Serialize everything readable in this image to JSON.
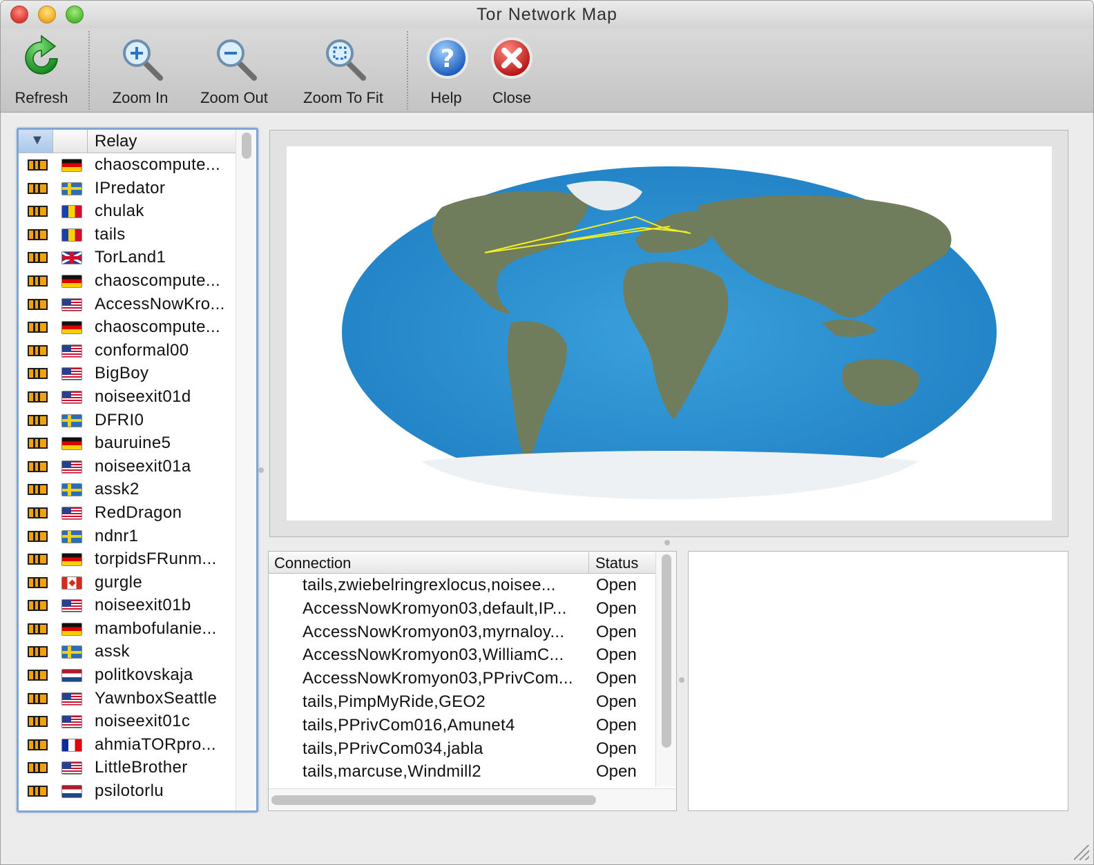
{
  "window": {
    "title": "Tor Network Map"
  },
  "toolbar": {
    "refresh": {
      "label": "Refresh",
      "icon": "refresh-icon"
    },
    "zoom_in": {
      "label": "Zoom In",
      "icon": "zoom-in-icon"
    },
    "zoom_out": {
      "label": "Zoom Out",
      "icon": "zoom-out-icon"
    },
    "zoom_fit": {
      "label": "Zoom To Fit",
      "icon": "zoom-to-fit-icon"
    },
    "help": {
      "label": "Help",
      "icon": "help-icon"
    },
    "close": {
      "label": "Close",
      "icon": "close-icon"
    }
  },
  "relay_list": {
    "header": "Relay",
    "sort_indicator": "▼",
    "items": [
      {
        "name": "chaoscompute...",
        "flag": "de"
      },
      {
        "name": "IPredator",
        "flag": "se"
      },
      {
        "name": "chulak",
        "flag": "ro"
      },
      {
        "name": "tails",
        "flag": "ro"
      },
      {
        "name": "TorLand1",
        "flag": "gb"
      },
      {
        "name": "chaoscompute...",
        "flag": "de"
      },
      {
        "name": "AccessNowKro...",
        "flag": "us"
      },
      {
        "name": "chaoscompute...",
        "flag": "de"
      },
      {
        "name": "conformal00",
        "flag": "us"
      },
      {
        "name": "BigBoy",
        "flag": "us"
      },
      {
        "name": "noiseexit01d",
        "flag": "us"
      },
      {
        "name": "DFRI0",
        "flag": "se"
      },
      {
        "name": "bauruine5",
        "flag": "de"
      },
      {
        "name": "noiseexit01a",
        "flag": "us"
      },
      {
        "name": "assk2",
        "flag": "se"
      },
      {
        "name": "RedDragon",
        "flag": "us"
      },
      {
        "name": "ndnr1",
        "flag": "se"
      },
      {
        "name": "torpidsFRunm...",
        "flag": "de"
      },
      {
        "name": "gurgle",
        "flag": "ca"
      },
      {
        "name": "noiseexit01b",
        "flag": "us"
      },
      {
        "name": "mambofulanie...",
        "flag": "de"
      },
      {
        "name": "assk",
        "flag": "se"
      },
      {
        "name": "politkovskaja",
        "flag": "nl"
      },
      {
        "name": "YawnboxSeattle",
        "flag": "us"
      },
      {
        "name": "noiseexit01c",
        "flag": "us"
      },
      {
        "name": "ahmiaTORpro...",
        "flag": "fr"
      },
      {
        "name": "LittleBrother",
        "flag": "us"
      },
      {
        "name": "psilotorlu",
        "flag": "nl"
      }
    ]
  },
  "connections": {
    "headers": {
      "connection": "Connection",
      "status": "Status"
    },
    "rows": [
      {
        "name": "tails,zwiebelringrexlocus,noisee...",
        "status": "Open"
      },
      {
        "name": "AccessNowKromyon03,default,IP...",
        "status": "Open"
      },
      {
        "name": "AccessNowKromyon03,myrnaloy...",
        "status": "Open"
      },
      {
        "name": "AccessNowKromyon03,WilliamC...",
        "status": "Open"
      },
      {
        "name": "AccessNowKromyon03,PPrivCom...",
        "status": "Open"
      },
      {
        "name": "tails,PimpMyRide,GEO2",
        "status": "Open"
      },
      {
        "name": "tails,PPrivCom016,Amunet4",
        "status": "Open"
      },
      {
        "name": "tails,PPrivCom034,jabla",
        "status": "Open"
      },
      {
        "name": "tails,marcuse,Windmill2",
        "status": "Open"
      }
    ]
  },
  "colors": {
    "accent": "#7fa6d6",
    "ocean": "#2f8fd0",
    "land": "#6f7d5c",
    "circuit_line": "#f2f020",
    "bandwidth": "#f5a10a"
  }
}
